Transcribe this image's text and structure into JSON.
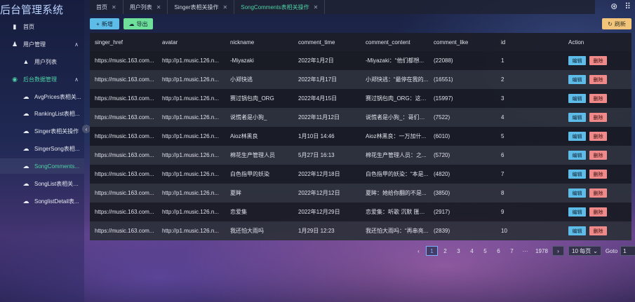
{
  "app": {
    "title": "后台管理系统"
  },
  "sidebar": {
    "items": [
      {
        "label": "首页",
        "icon": "home-icon",
        "glyph": "▮"
      },
      {
        "label": "用户管理",
        "icon": "user-icon",
        "glyph": "♟",
        "chevron": "∧"
      },
      {
        "label": "用户列表",
        "icon": "warning-icon",
        "glyph": "▲"
      },
      {
        "label": "后台数据管理",
        "icon": "data-icon",
        "glyph": "◉",
        "chevron": "∧"
      },
      {
        "label": "AvgPrices表相关...",
        "icon": "cloud-icon",
        "glyph": "☁"
      },
      {
        "label": "RankingList表相...",
        "icon": "cloud-icon",
        "glyph": "☁"
      },
      {
        "label": "Singer表相关操作",
        "icon": "cloud-icon",
        "glyph": "☁"
      },
      {
        "label": "SingerSong表相...",
        "icon": "cloud-icon",
        "glyph": "☁"
      },
      {
        "label": "SongComments...",
        "icon": "cloud-icon",
        "glyph": "☁"
      },
      {
        "label": "SongList表相关操作",
        "icon": "cloud-icon",
        "glyph": "☁"
      },
      {
        "label": "SonglistDetail表...",
        "icon": "cloud-icon",
        "glyph": "☁"
      }
    ],
    "collapse_glyph": "‹"
  },
  "tabs": [
    {
      "label": "首页",
      "close": "✕"
    },
    {
      "label": "用户列表",
      "close": "✕"
    },
    {
      "label": "Singer表相关操作",
      "close": "✕"
    },
    {
      "label": "SongComments表相关操作",
      "close": "✕"
    }
  ],
  "top_icons": {
    "theme": "⊛",
    "apps": "⠿"
  },
  "toolbar": {
    "add_label": "新增",
    "add_glyph": "+",
    "export_label": "导出",
    "export_glyph": "☁",
    "refresh_label": "刷新",
    "refresh_glyph": "↻"
  },
  "table": {
    "headers": [
      "singer_href",
      "avatar",
      "nickname",
      "comment_time",
      "comment_content",
      "comment_like",
      "id",
      "Action"
    ],
    "edit_label": "编辑",
    "delete_label": "删除",
    "rows": [
      [
        "https://music.163.com...",
        "http://p1.music.126.n...",
        "-Miyazaki",
        "2022年1月2日",
        "-Miyazaki：“他们都想...",
        "(22088)",
        "1"
      ],
      [
        "https://music.163.com...",
        "http://p1.music.126.n...",
        "小郑快逃",
        "2022年1月17日",
        "小郑快逃：“最停在我的...",
        "(16551)",
        "2"
      ],
      [
        "https://music.163.com...",
        "http://p1.music.126.n...",
        "赛过锅包肉_ORG",
        "2022年4月15日",
        "赛过锅包肉_ORG：这个...",
        "(15997)",
        "3"
      ],
      [
        "https://music.163.com...",
        "http://p1.music.126.n...",
        "说慌者是小狗_",
        "2022年11月12日",
        "说慌者是小狗_：哥们哥...",
        "(7522)",
        "4"
      ],
      [
        "https://music.163.com...",
        "http://p1.music.126.n...",
        "Aioz林黑良",
        "1月10日 14:46",
        "Aioz林黑良：一万加什...",
        "(6010)",
        "5"
      ],
      [
        "https://music.163.com...",
        "http://p1.music.126.n...",
        "棉花生产管理人员",
        "5月27日 16:13",
        "棉花生产管理人员：之...",
        "(5720)",
        "6"
      ],
      [
        "https://music.163.com...",
        "http://p1.music.126.n...",
        "白色指甲的妖染",
        "2022年12月18日",
        "白色指甲的妖染：“本是...",
        "(4820)",
        "7"
      ],
      [
        "https://music.163.com...",
        "http://p1.music.126.n...",
        "夏眸",
        "2022年12月12日",
        "夏眸：她给你翻的不是...",
        "(3850)",
        "8"
      ],
      [
        "https://music.163.com...",
        "http://p1.music.126.n...",
        "恋爱集",
        "2022年12月29日",
        "恋爱集：听歌 沉默 匯完...",
        "(2917)",
        "9"
      ],
      [
        "https://music.163.com...",
        "http://p1.music.126.n...",
        "我还怕大雨吗",
        "1月29日 12:23",
        "我还怕大雨吗：“再串亮...",
        "(2839)",
        "10"
      ]
    ]
  },
  "pagination": {
    "prev": "‹",
    "pages": [
      "1",
      "2",
      "3",
      "4",
      "5",
      "6",
      "7"
    ],
    "ellipsis": "···",
    "last": "1978",
    "next": "›",
    "page_size": "10 每页",
    "page_size_chevron": "⌄",
    "goto_label": "Goto",
    "goto_value": "1"
  }
}
